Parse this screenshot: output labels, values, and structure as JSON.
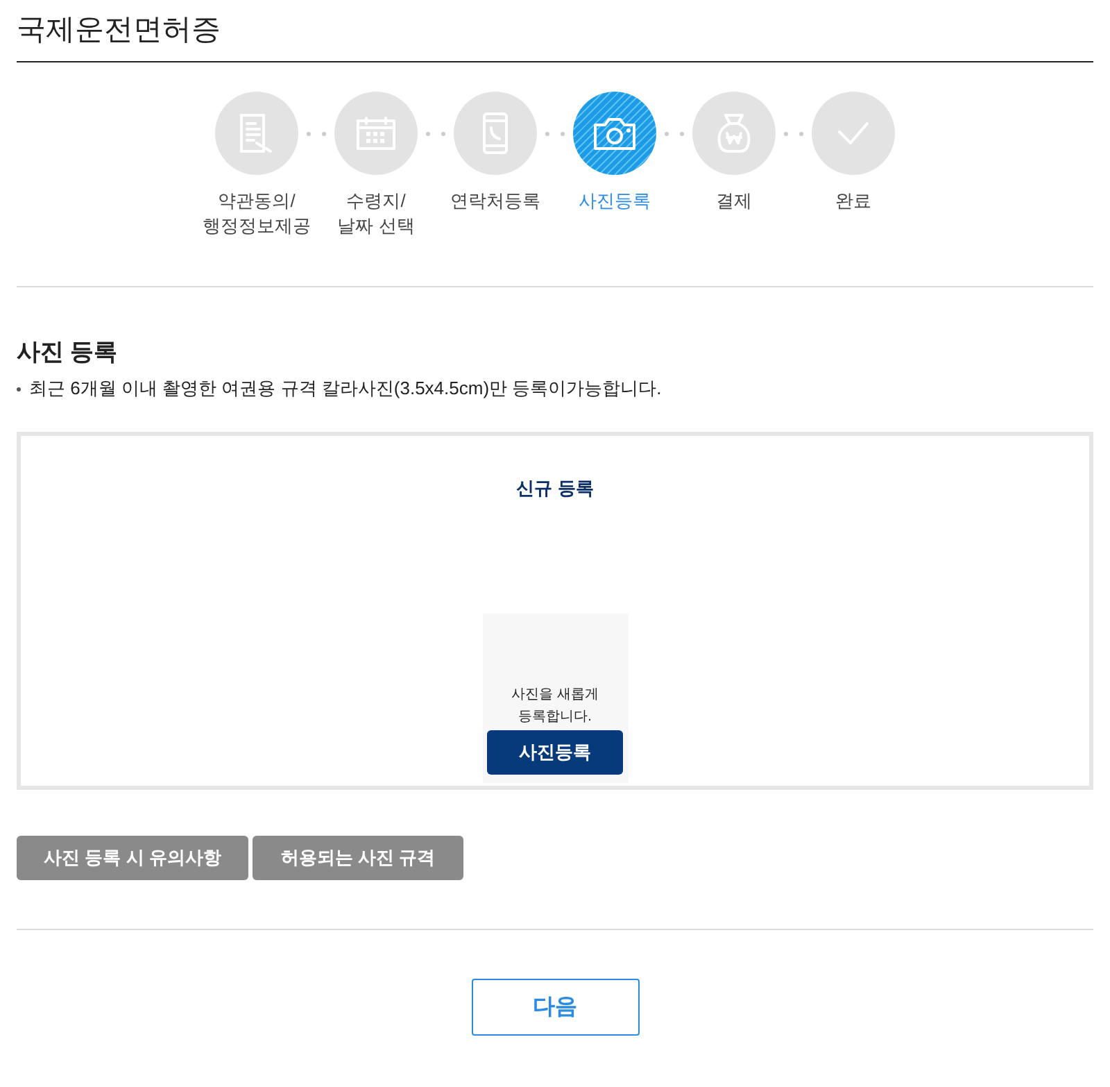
{
  "page_title": "국제운전면허증",
  "steps": [
    {
      "kind": "document",
      "label": "약관동의/\n행정정보제공",
      "selected": false
    },
    {
      "kind": "calendar",
      "label": "수령지/\n날짜 선택",
      "selected": false
    },
    {
      "kind": "phone",
      "label": "연락처등록",
      "selected": false
    },
    {
      "kind": "camera",
      "label": "사진등록",
      "selected": true
    },
    {
      "kind": "money",
      "label": "결제",
      "selected": false
    },
    {
      "kind": "check",
      "label": "완료",
      "selected": false
    }
  ],
  "section": {
    "heading": "사진 등록",
    "note": "최근 6개월 이내 촬영한 여권용 규격 칼라사진(3.5x4.5cm)만 등록이가능합니다."
  },
  "upload": {
    "title": "신규 등록",
    "hint": "사진을 새롭게\n등록합니다.",
    "button": "사진등록"
  },
  "info_buttons": [
    "사진 등록 시 유의사항",
    "허용되는 사진 규격"
  ],
  "next_button": "다음"
}
